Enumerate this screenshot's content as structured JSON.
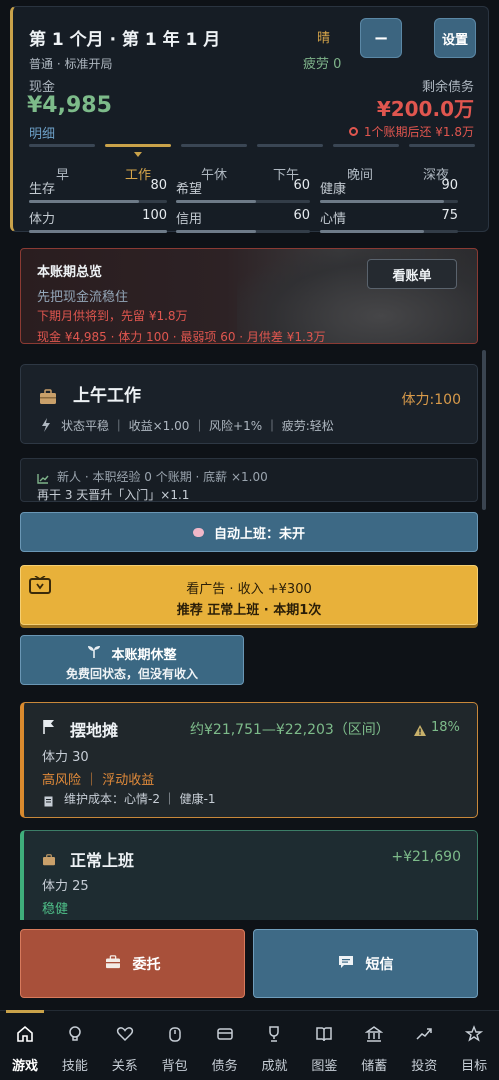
{
  "header": {
    "title": "第 1 个月 · 第 1 年 1 月",
    "weather": "晴",
    "fatigue": "疲劳 0",
    "minus_label": "−",
    "settings_label": "设置",
    "mode": "普通 · 标准开局"
  },
  "cash": {
    "label": "现金",
    "value": "¥4,985",
    "detail_label": "明细"
  },
  "debt": {
    "label": "剩余债务",
    "value": "¥200.0万",
    "note": "1个账期后还 ¥1.8万"
  },
  "time_slots": [
    "早",
    "工作",
    "午休",
    "下午",
    "晚间",
    "深夜"
  ],
  "active_slot": "工作",
  "stats": [
    {
      "label": "生存",
      "value": "80",
      "level": 0.8
    },
    {
      "label": "希望",
      "value": "60",
      "level": 0.6
    },
    {
      "label": "健康",
      "value": "90",
      "level": 0.9
    },
    {
      "label": "体力",
      "value": "100",
      "level": 1.0
    },
    {
      "label": "信用",
      "value": "60",
      "level": 0.6
    },
    {
      "label": "心情",
      "value": "75",
      "level": 0.75
    }
  ],
  "summary": {
    "title": "本账期总览",
    "view_button": "看账单",
    "tip": "先把现金流稳住",
    "line1": "下期月供将到，先留 ¥1.8万",
    "line2": "现金 ¥4,985 · 体力 100 · 最弱项 60 · 月供差 ¥1.3万"
  },
  "work": {
    "title": "上午工作",
    "stamina": "体力:100",
    "status": "状态平稳 ｜ 收益×1.00 ｜ 风险+1% ｜ 疲劳:轻松"
  },
  "experience": {
    "line1": "新人 · 本职经验 0 个账期 · 底薪 ×1.00",
    "line2": "再干 3 天晋升「入门」×1.1"
  },
  "auto_work": {
    "label": "自动上班：未开"
  },
  "ad": {
    "line1": "看广告 · 收入 +¥300",
    "line2": "推荐 正常上班 · 本期1次"
  },
  "rest": {
    "line1": "本账期休整",
    "line2": "免费回状态，但没有收入"
  },
  "stall": {
    "title": "摆地摊",
    "income": "约¥21,751—¥22,203（区间）",
    "risk": "18%",
    "stamina": "体力 30",
    "tags": "高风险 ｜ 浮动收益",
    "cost": "维护成本：心情-2 ｜ 健康-1"
  },
  "job": {
    "title": "正常上班",
    "income": "+¥21,690",
    "stamina": "体力 25",
    "tag": "稳健"
  },
  "actions": {
    "delegate": "委托",
    "sms": "短信"
  },
  "nav": [
    {
      "label": "游戏",
      "icon": "home-icon"
    },
    {
      "label": "技能",
      "icon": "bulb-icon"
    },
    {
      "label": "关系",
      "icon": "heart-icon"
    },
    {
      "label": "背包",
      "icon": "backpack-icon"
    },
    {
      "label": "债务",
      "icon": "card-icon"
    },
    {
      "label": "成就",
      "icon": "trophy-icon"
    },
    {
      "label": "图鉴",
      "icon": "book-icon"
    },
    {
      "label": "储蓄",
      "icon": "bank-icon"
    },
    {
      "label": "投资",
      "icon": "chart-up-icon"
    },
    {
      "label": "目标",
      "icon": "star-icon"
    }
  ],
  "active_nav": "游戏",
  "colors": {
    "accent_gold": "#c9a24a",
    "cash_green": "#7dbb8a",
    "debt_red": "#e0564f",
    "ad_yellow": "#e8b13a",
    "delegate_red": "#a8503a"
  }
}
